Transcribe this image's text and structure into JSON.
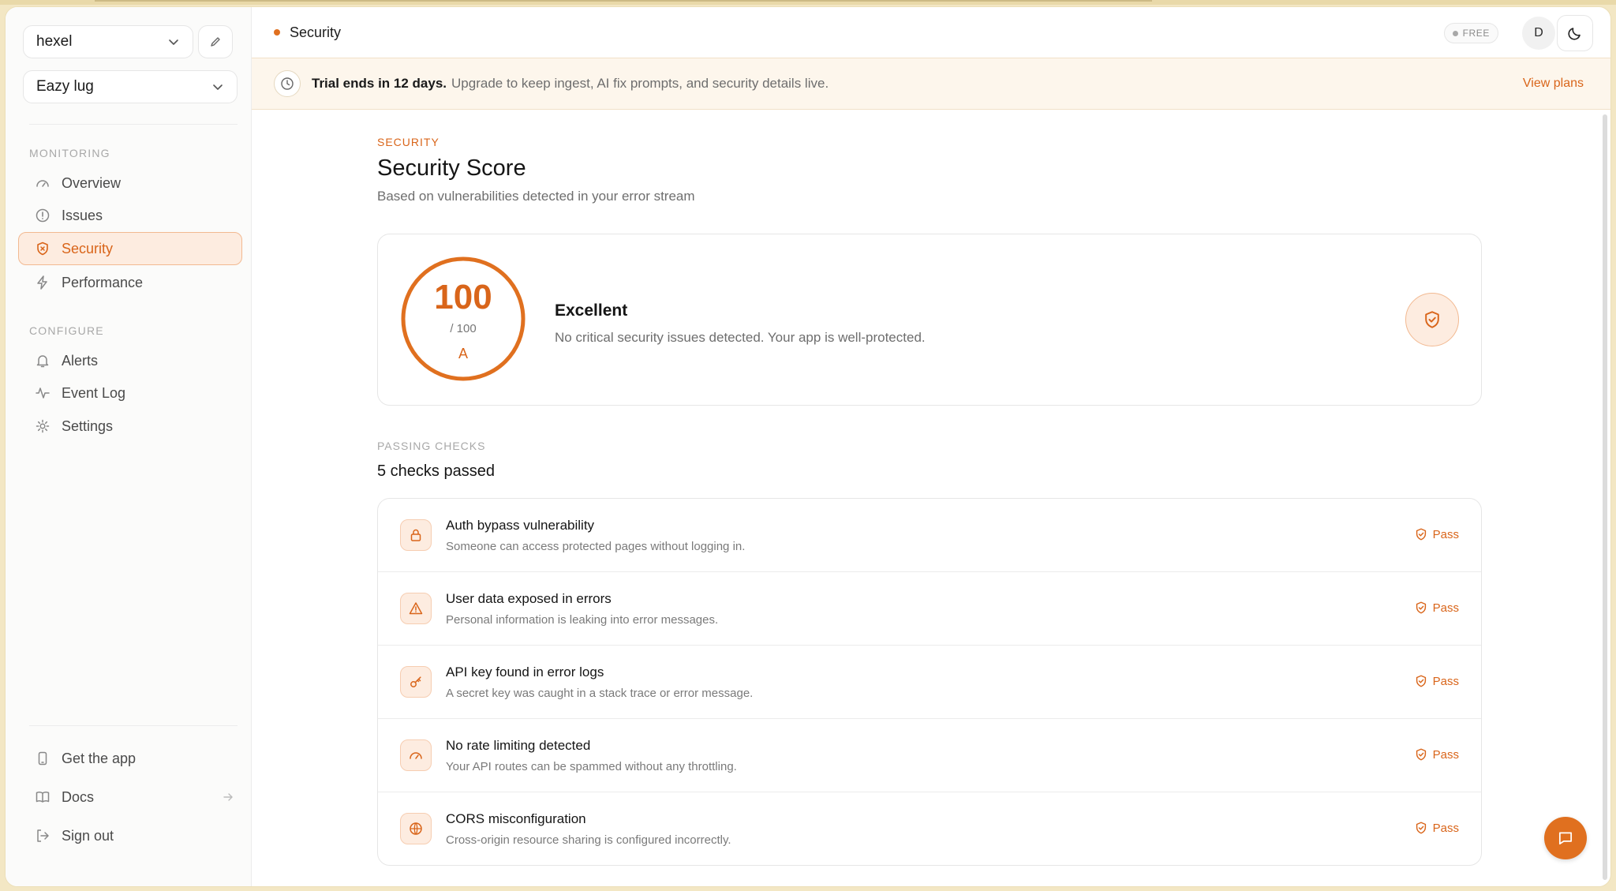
{
  "workspace": {
    "name": "hexel"
  },
  "project": {
    "name": "Eazy lug"
  },
  "sidebar": {
    "monitoring_label": "MONITORING",
    "configure_label": "CONFIGURE",
    "monitoring_items": [
      {
        "label": "Overview",
        "icon": "gauge-icon"
      },
      {
        "label": "Issues",
        "icon": "alert-circle-icon"
      },
      {
        "label": "Security",
        "icon": "shield-icon",
        "active": true
      },
      {
        "label": "Performance",
        "icon": "bolt-icon"
      }
    ],
    "configure_items": [
      {
        "label": "Alerts",
        "icon": "bell-icon"
      },
      {
        "label": "Event Log",
        "icon": "activity-icon"
      },
      {
        "label": "Settings",
        "icon": "gear-icon"
      }
    ],
    "footer_items": [
      {
        "label": "Get the app",
        "icon": "phone-icon"
      },
      {
        "label": "Docs",
        "icon": "book-icon"
      },
      {
        "label": "Sign out",
        "icon": "sign-out-icon"
      }
    ]
  },
  "header": {
    "breadcrumb": "Security",
    "plan_badge": "FREE",
    "avatar_initial": "D"
  },
  "banner": {
    "strong": "Trial ends in 12 days.",
    "text": "Upgrade to keep ingest, AI fix prompts, and security details live.",
    "link": "View plans"
  },
  "page": {
    "eyebrow": "SECURITY",
    "title": "Security Score",
    "subtitle": "Based on vulnerabilities detected in your error stream"
  },
  "score": {
    "value": "100",
    "out_of": "/ 100",
    "grade": "A",
    "label": "Excellent",
    "description": "No critical security issues detected. Your app is well-protected.",
    "fill_fraction": 1.0
  },
  "checks": {
    "eyebrow": "PASSING CHECKS",
    "title": "5 checks passed",
    "items": [
      {
        "title": "Auth bypass vulnerability",
        "description": "Someone can access protected pages without logging in.",
        "status": "Pass",
        "icon": "lock-icon"
      },
      {
        "title": "User data exposed in errors",
        "description": "Personal information is leaking into error messages.",
        "status": "Pass",
        "icon": "warning-icon"
      },
      {
        "title": "API key found in error logs",
        "description": "A secret key was caught in a stack trace or error message.",
        "status": "Pass",
        "icon": "key-icon"
      },
      {
        "title": "No rate limiting detected",
        "description": "Your API routes can be spammed without any throttling.",
        "status": "Pass",
        "icon": "gauge-icon"
      },
      {
        "title": "CORS misconfiguration",
        "description": "Cross-origin resource sharing is configured incorrectly.",
        "status": "Pass",
        "icon": "globe-icon"
      }
    ]
  },
  "colors": {
    "accent": "#e0701f",
    "accent_soft": "#fdece0",
    "muted_text": "#6e6e6e"
  }
}
